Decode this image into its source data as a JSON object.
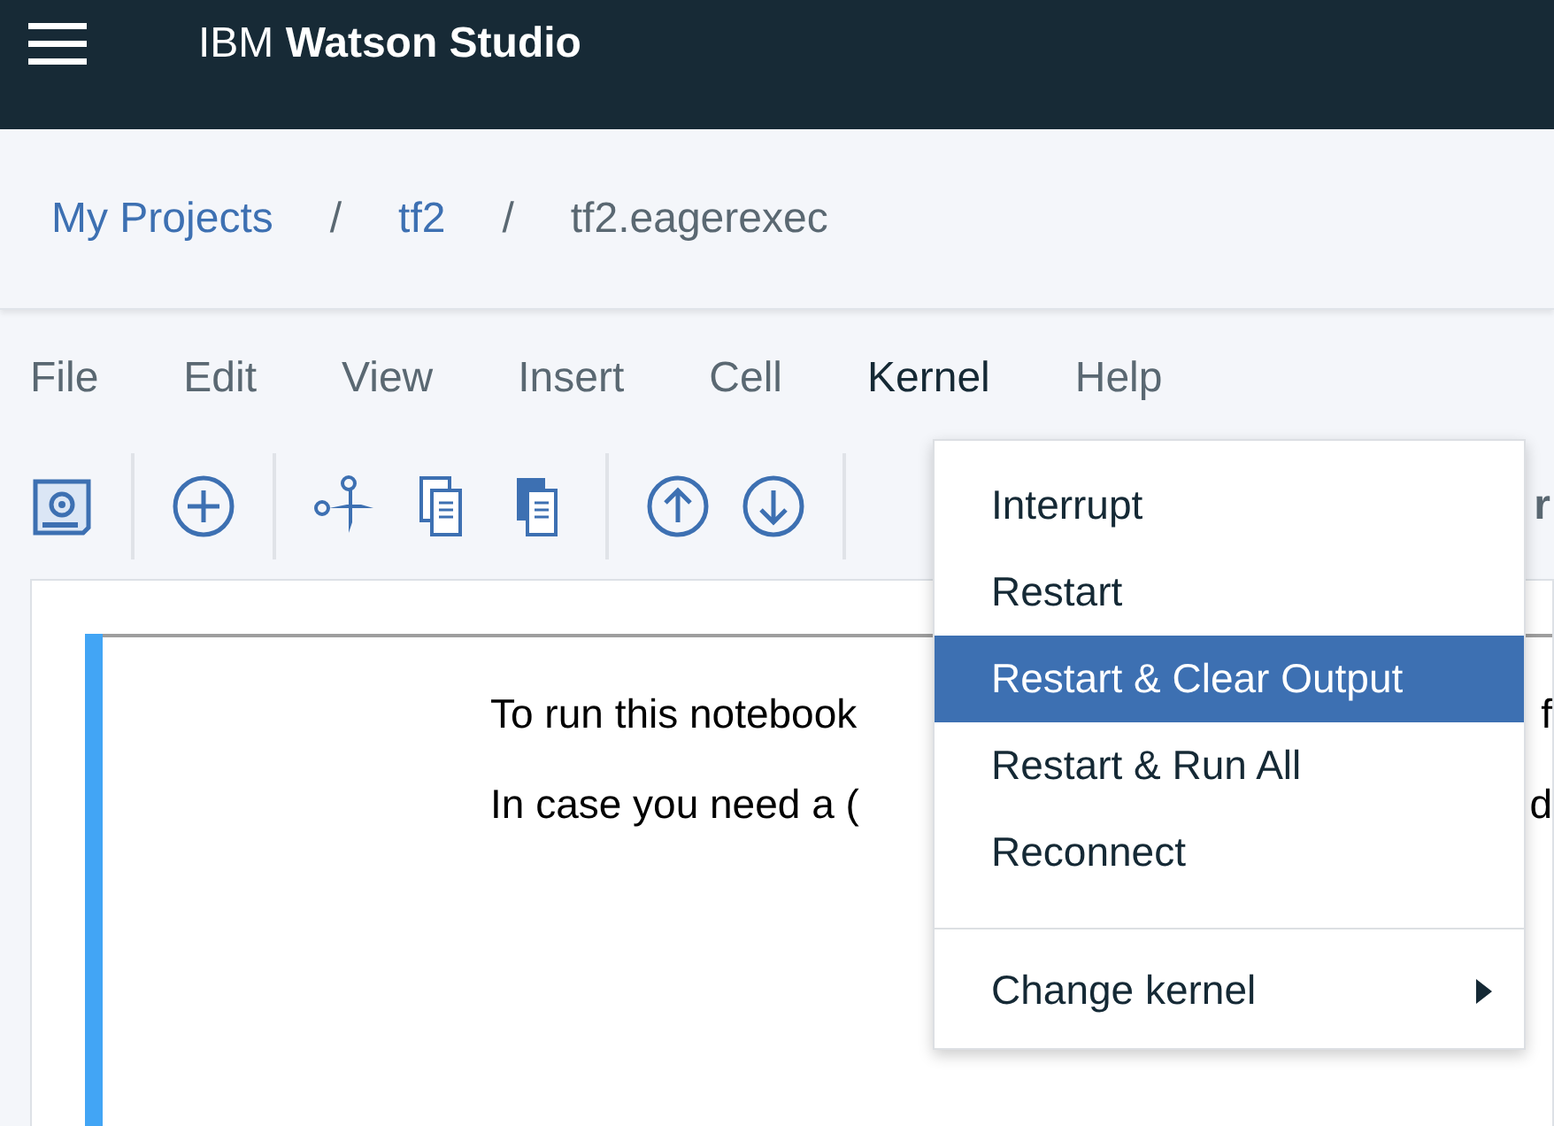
{
  "header": {
    "title_light": "IBM",
    "title_bold": "Watson Studio"
  },
  "breadcrumb": [
    {
      "label": "My Projects",
      "kind": "link"
    },
    {
      "label": "/",
      "kind": "separator"
    },
    {
      "label": "tf2",
      "kind": "link"
    },
    {
      "label": "/",
      "kind": "separator"
    },
    {
      "label": "tf2.eagerexec",
      "kind": "current"
    }
  ],
  "menubar": [
    {
      "label": "File",
      "selected": false
    },
    {
      "label": "Edit",
      "selected": false
    },
    {
      "label": "View",
      "selected": false
    },
    {
      "label": "Insert",
      "selected": false
    },
    {
      "label": "Cell",
      "selected": false
    },
    {
      "label": "Kernel",
      "selected": true
    },
    {
      "label": "Help",
      "selected": false
    }
  ],
  "toolbar": {
    "cut_text": "r"
  },
  "cell": {
    "lines": [
      {
        "text": "To run this notebook",
        "tail": "f"
      },
      {
        "text": "In case you need a (",
        "tail": "d"
      }
    ]
  },
  "dropdown": {
    "items": [
      {
        "kind": "item",
        "label": "Interrupt",
        "selected": false
      },
      {
        "kind": "item",
        "label": "Restart",
        "selected": false
      },
      {
        "kind": "item",
        "label": "Restart & Clear Output",
        "selected": true
      },
      {
        "kind": "item",
        "label": "Restart & Run All",
        "selected": false
      },
      {
        "kind": "item",
        "label": "Reconnect",
        "selected": false
      },
      {
        "kind": "divider"
      },
      {
        "kind": "submenu",
        "label": "Change kernel",
        "selected": false
      }
    ]
  }
}
